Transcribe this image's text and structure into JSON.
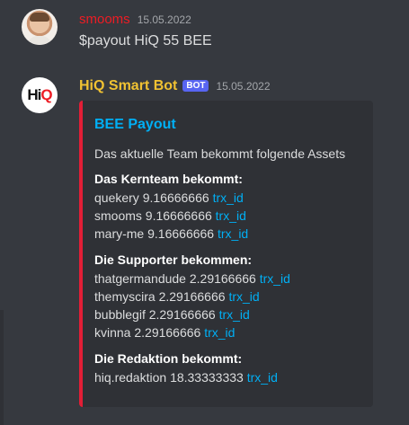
{
  "messages": [
    {
      "author": "smooms",
      "timestamp": "15.05.2022",
      "text": "$payout HiQ 55 BEE"
    },
    {
      "author": "HiQ Smart Bot",
      "bot_tag": "BOT",
      "timestamp": "15.05.2022",
      "avatar_logo": {
        "part1": "Hi",
        "part2": "Q"
      },
      "embed": {
        "color": "#e21e36",
        "title": "BEE Payout",
        "description": "Das aktuelle Team bekommt folgende Assets",
        "fields": [
          {
            "name": "Das Kernteam bekommt:",
            "rows": [
              {
                "user": "quekery",
                "amount": "9.16666666",
                "link": "trx_id"
              },
              {
                "user": "smooms",
                "amount": "9.16666666",
                "link": "trx_id"
              },
              {
                "user": "mary-me",
                "amount": "9.16666666",
                "link": "trx_id"
              }
            ]
          },
          {
            "name": "Die Supporter bekommen:",
            "rows": [
              {
                "user": "thatgermandude",
                "amount": "2.29166666",
                "link": "trx_id"
              },
              {
                "user": "themyscira",
                "amount": "2.29166666",
                "link": "trx_id"
              },
              {
                "user": "bubblegif",
                "amount": "2.29166666",
                "link": "trx_id"
              },
              {
                "user": "kvinna",
                "amount": "2.29166666",
                "link": "trx_id"
              }
            ]
          },
          {
            "name": "Die Redaktion bekommt:",
            "rows": [
              {
                "user": "hiq.redaktion",
                "amount": "18.33333333",
                "link": "trx_id"
              }
            ]
          }
        ]
      }
    }
  ]
}
